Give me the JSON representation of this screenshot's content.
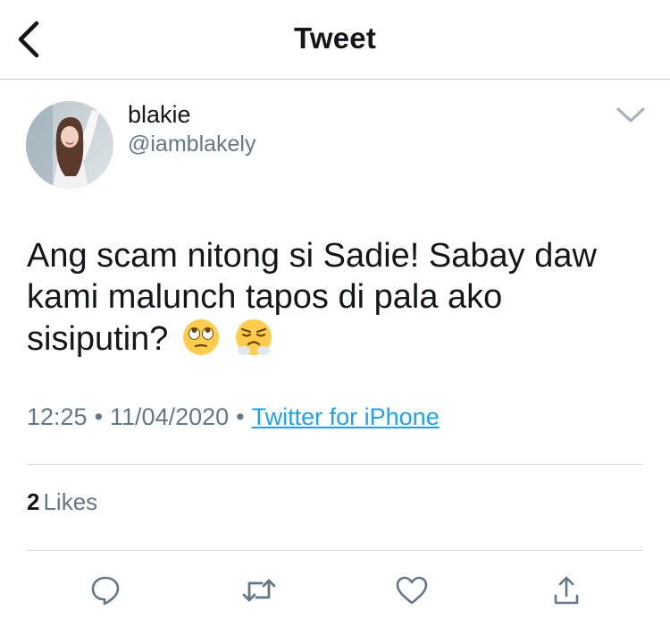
{
  "header": {
    "title": "Tweet",
    "back_icon": "chevron-left-icon"
  },
  "author": {
    "name": "blakie",
    "handle": "@iamblakely"
  },
  "tweet": {
    "text": "Ang scam nitong si Sadie! Sabay daw kami malunch tapos di pala ako sisiputin?",
    "emojis": [
      "face-with-rolling-eyes",
      "face-with-steam-from-nose"
    ]
  },
  "meta": {
    "time": "12:25",
    "separator": "•",
    "date": "11/04/2020",
    "source": "Twitter for iPhone"
  },
  "likes": {
    "count": "2",
    "label": "Likes"
  },
  "actions": [
    "reply-icon",
    "retweet-icon",
    "like-icon",
    "share-icon"
  ],
  "colors": {
    "link": "#1da1f2",
    "secondary": "#657786",
    "icon": "#657786",
    "text": "#14171a"
  }
}
